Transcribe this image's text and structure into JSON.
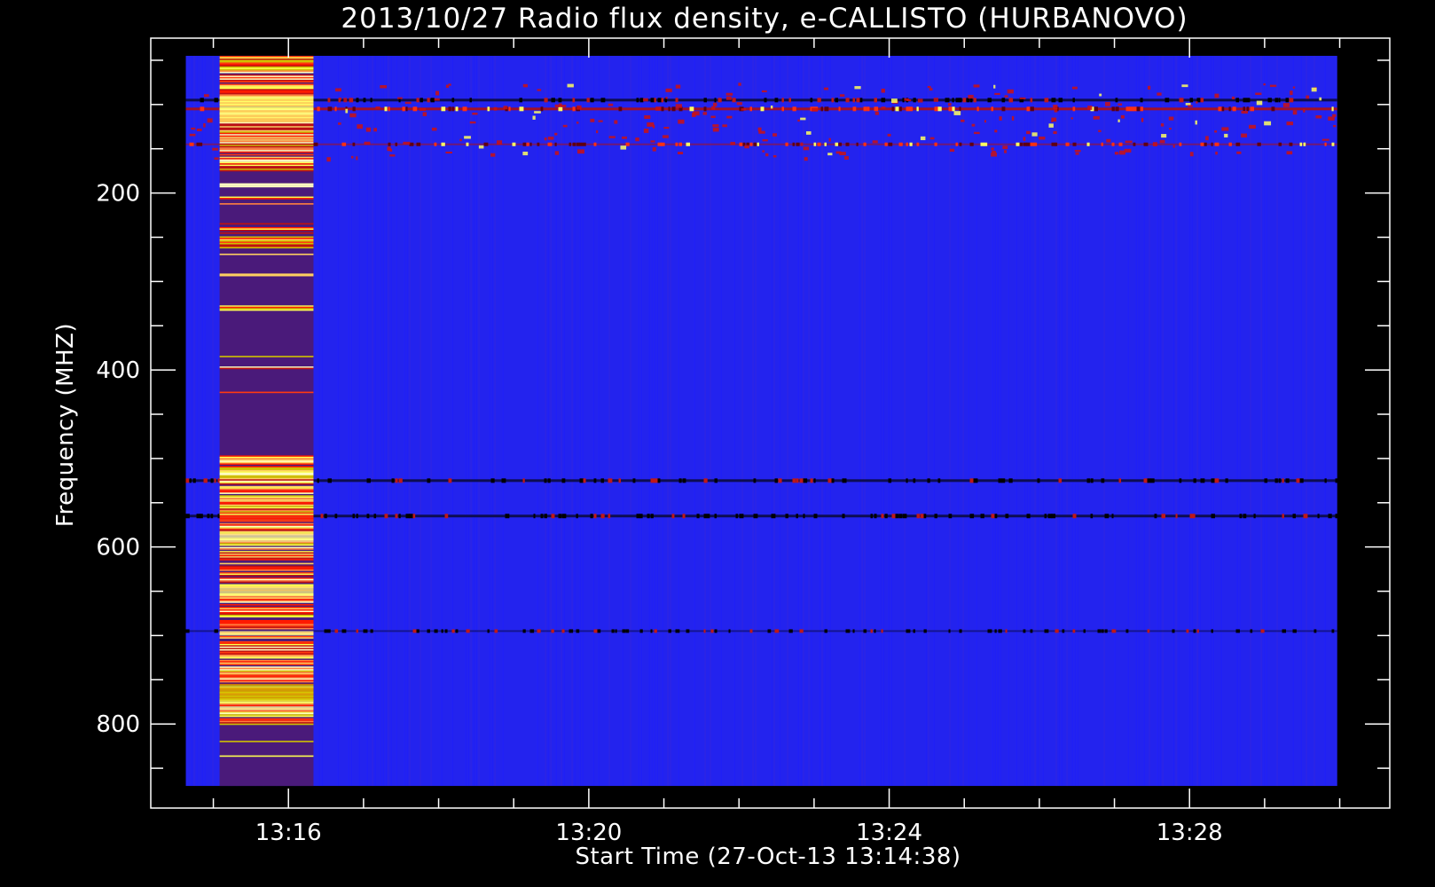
{
  "chart_data": {
    "type": "heatmap",
    "title": "2013/10/27  Radio flux density, e-CALLISTO (HURBANOVO)",
    "xlabel": "Start Time (27-Oct-13 13:14:38)",
    "ylabel": "Frequency (MHZ)",
    "x_range": [
      "13:14:38",
      "13:29:58"
    ],
    "xlim": [
      "13:14:10",
      "13:30:40"
    ],
    "x_ticks": [
      {
        "value": "13:16",
        "label": "13:16"
      },
      {
        "value": "13:20",
        "label": "13:20"
      },
      {
        "value": "13:24",
        "label": "13:24"
      },
      {
        "value": "13:28",
        "label": "13:28"
      }
    ],
    "x_minor_ticks": [
      "13:15",
      "13:17",
      "13:18",
      "13:19",
      "13:21",
      "13:22",
      "13:23",
      "13:25",
      "13:26",
      "13:27",
      "13:29",
      "13:30"
    ],
    "y_range": [
      45,
      870
    ],
    "ylim": [
      25,
      895
    ],
    "y_inverted": true,
    "y_ticks": [
      {
        "value": 200,
        "label": "200"
      },
      {
        "value": 400,
        "label": "400"
      },
      {
        "value": 600,
        "label": "600"
      },
      {
        "value": 800,
        "label": "800"
      }
    ],
    "y_minor_ticks": [
      50,
      100,
      150,
      250,
      300,
      350,
      450,
      500,
      550,
      650,
      700,
      750,
      850
    ],
    "colormap": [
      "#000000",
      "#1b0f6b",
      "#2020ff",
      "#c00000",
      "#ff2000",
      "#ff8030",
      "#ffff40",
      "#ffffc0"
    ],
    "background_color": "#2323ee",
    "features": [
      {
        "kind": "burst",
        "time_start": "13:15:05",
        "time_end": "13:16:20",
        "freq_min": 45,
        "freq_max": 870
      },
      {
        "kind": "rfi_line",
        "freq": 95,
        "intensity": "dark"
      },
      {
        "kind": "rfi_line",
        "freq": 105,
        "intensity": "red"
      },
      {
        "kind": "rfi_line",
        "freq": 145,
        "intensity": "red-faint"
      },
      {
        "kind": "rfi_line",
        "freq": 525,
        "intensity": "dark"
      },
      {
        "kind": "rfi_line",
        "freq": 565,
        "intensity": "dark"
      },
      {
        "kind": "rfi_line",
        "freq": 695,
        "intensity": "dark-faint"
      }
    ]
  }
}
